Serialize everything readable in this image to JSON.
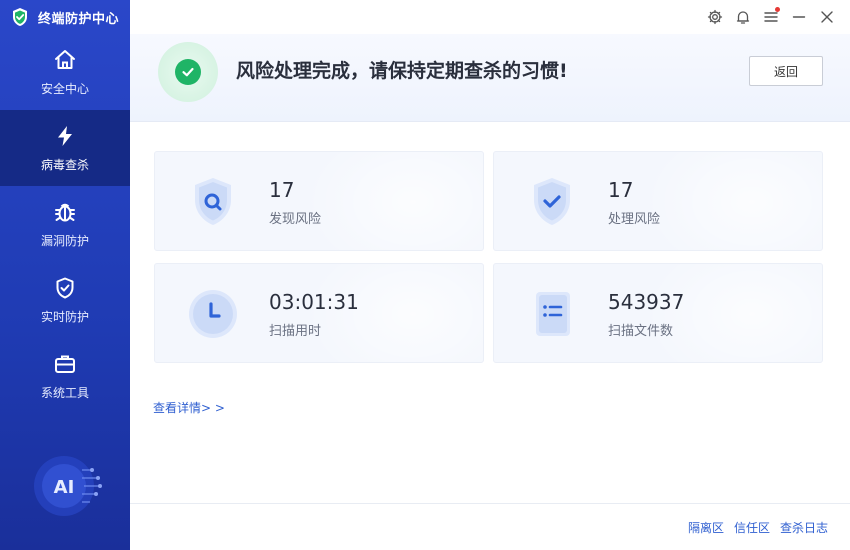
{
  "app": {
    "title": "终端防护中心"
  },
  "sidebar": {
    "items": [
      {
        "label": "安全中心",
        "icon": "home-icon",
        "active": false
      },
      {
        "label": "病毒查杀",
        "icon": "lightning-icon",
        "active": true
      },
      {
        "label": "漏洞防护",
        "icon": "bug-icon",
        "active": false
      },
      {
        "label": "实时防护",
        "icon": "shield-check-icon",
        "active": false
      },
      {
        "label": "系统工具",
        "icon": "toolbox-icon",
        "active": false
      }
    ],
    "ai_badge": "AI"
  },
  "banner": {
    "message": "风险处理完成，请保持定期查杀的习惯!",
    "return_label": "返回"
  },
  "stats": [
    {
      "value": "17",
      "label": "发现风险",
      "icon": "shield-search-icon"
    },
    {
      "value": "17",
      "label": "处理风险",
      "icon": "shield-check-icon"
    },
    {
      "value": "03:01:31",
      "label": "扫描用时",
      "icon": "clock-icon"
    },
    {
      "value": "543937",
      "label": "扫描文件数",
      "icon": "document-list-icon"
    }
  ],
  "detail_link": "查看详情> >",
  "footer": {
    "links": [
      "隔离区",
      "信任区",
      "查杀日志"
    ]
  },
  "colors": {
    "sidebar": "#1f3bb3",
    "sidebar_active": "#152a86",
    "accent_green": "#1fb466",
    "link_blue": "#2f5fd0"
  }
}
